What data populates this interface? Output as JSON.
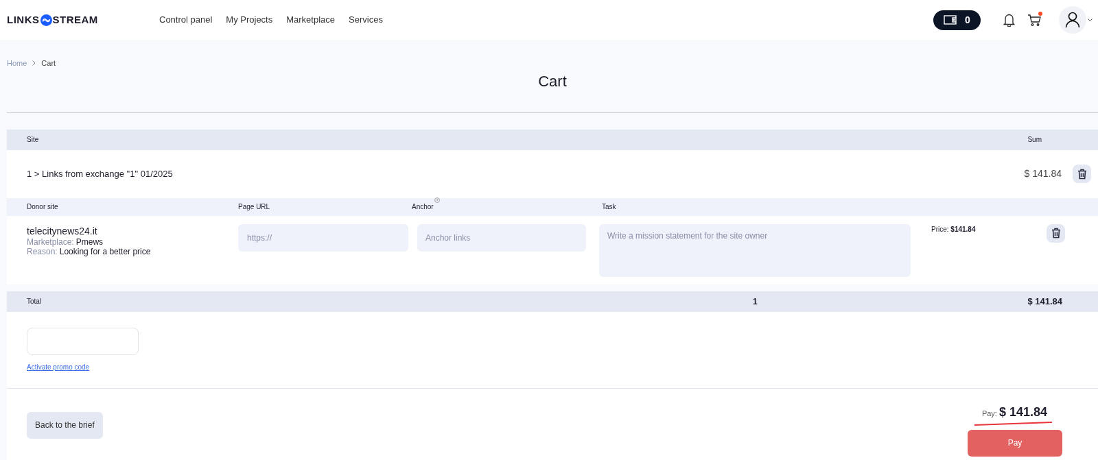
{
  "header": {
    "logo_left": "LINKS",
    "logo_right": "STREAM",
    "nav": [
      "Control panel",
      "My Projects",
      "Marketplace",
      "Services"
    ],
    "wallet": "0",
    "cart_has_notification": true
  },
  "breadcrumb": [
    "Home",
    "Cart"
  ],
  "title": "Cart",
  "table": {
    "columns": [
      "Site",
      "Sum"
    ],
    "group": {
      "name": "1 > Links from exchange \"1\" 01/2025",
      "sum": "$ 141.84"
    },
    "subcolumns": [
      "Donor site",
      "Page URL",
      "Anchor",
      "Task"
    ],
    "items": [
      {
        "site": "telecitynews24.it",
        "marketplace_label": "Marketplace:",
        "marketplace": "Pmews",
        "reason_label": "Reason:",
        "reason": "Looking for a better price",
        "url_placeholder": "https://",
        "anchor_placeholder": "Anchor links",
        "task_placeholder": "Write a mission statement for the site owner",
        "price": "Price: **$141.84**"
      }
    ],
    "total": {
      "label": "Total",
      "count": "1",
      "sum": "$ 141.84"
    }
  },
  "promo": {
    "link": "Activate promo code"
  },
  "back_button": "Back to the brief",
  "pay": {
    "label": "Pay:",
    "amount": "$ 141.84",
    "button": "Pay"
  }
}
